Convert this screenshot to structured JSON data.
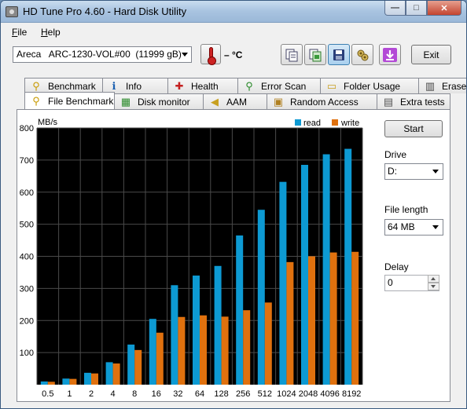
{
  "window": {
    "title": "HD Tune Pro 4.60 - Hard Disk Utility",
    "minimize_label": "—",
    "maximize_label": "□",
    "close_label": "✕"
  },
  "menu": {
    "items": [
      {
        "accel": "F",
        "rest": "ile"
      },
      {
        "accel": "H",
        "rest": "elp"
      }
    ]
  },
  "toolbar": {
    "drive": "Areca   ARC-1230-VOL#00  (11999 gB)",
    "temperature": "– °C",
    "exit_label": "Exit",
    "icons": [
      "copy-info-icon",
      "copy-screenshot-icon",
      "save-icon",
      "options-icon",
      "download-icon"
    ]
  },
  "tabs": {
    "row1": [
      {
        "label": "Benchmark",
        "icon": "benchmark-icon"
      },
      {
        "label": "Info",
        "icon": "info-icon"
      },
      {
        "label": "Health",
        "icon": "health-icon"
      },
      {
        "label": "Error Scan",
        "icon": "error-scan-icon"
      },
      {
        "label": "Folder Usage",
        "icon": "folder-usage-icon"
      },
      {
        "label": "Erase",
        "icon": "erase-icon"
      }
    ],
    "row2": [
      {
        "label": "File Benchmark",
        "icon": "file-benchmark-icon",
        "active": true
      },
      {
        "label": "Disk monitor",
        "icon": "disk-monitor-icon"
      },
      {
        "label": "AAM",
        "icon": "aam-icon"
      },
      {
        "label": "Random Access",
        "icon": "random-access-icon"
      },
      {
        "label": "Extra tests",
        "icon": "extra-tests-icon"
      }
    ]
  },
  "controls": {
    "start_label": "Start",
    "drive_label": "Drive",
    "drive_value": "D:",
    "file_length_label": "File length",
    "file_length_value": "64 MB",
    "delay_label": "Delay",
    "delay_value": "0"
  },
  "colors": {
    "read": "#0d9ad3",
    "write": "#e0710e",
    "plot_bg": "#000000",
    "grid": "#4a4a4a"
  },
  "chart_data": {
    "type": "bar",
    "ylabel": "MB/s",
    "ylim": [
      0,
      800
    ],
    "yticks": [
      100,
      200,
      300,
      400,
      500,
      600,
      700,
      800
    ],
    "grid": true,
    "legend_position": "top-right",
    "categories": [
      "0.5",
      "1",
      "2",
      "4",
      "8",
      "16",
      "32",
      "64",
      "128",
      "256",
      "512",
      "1024",
      "2048",
      "4096",
      "8192"
    ],
    "series": [
      {
        "name": "read",
        "values": [
          10,
          19,
          37,
          70,
          125,
          205,
          310,
          340,
          370,
          465,
          545,
          632,
          685,
          718,
          735
        ]
      },
      {
        "name": "write",
        "values": [
          9,
          18,
          35,
          66,
          108,
          162,
          211,
          216,
          212,
          232,
          256,
          382,
          400,
          412,
          414
        ]
      }
    ]
  }
}
